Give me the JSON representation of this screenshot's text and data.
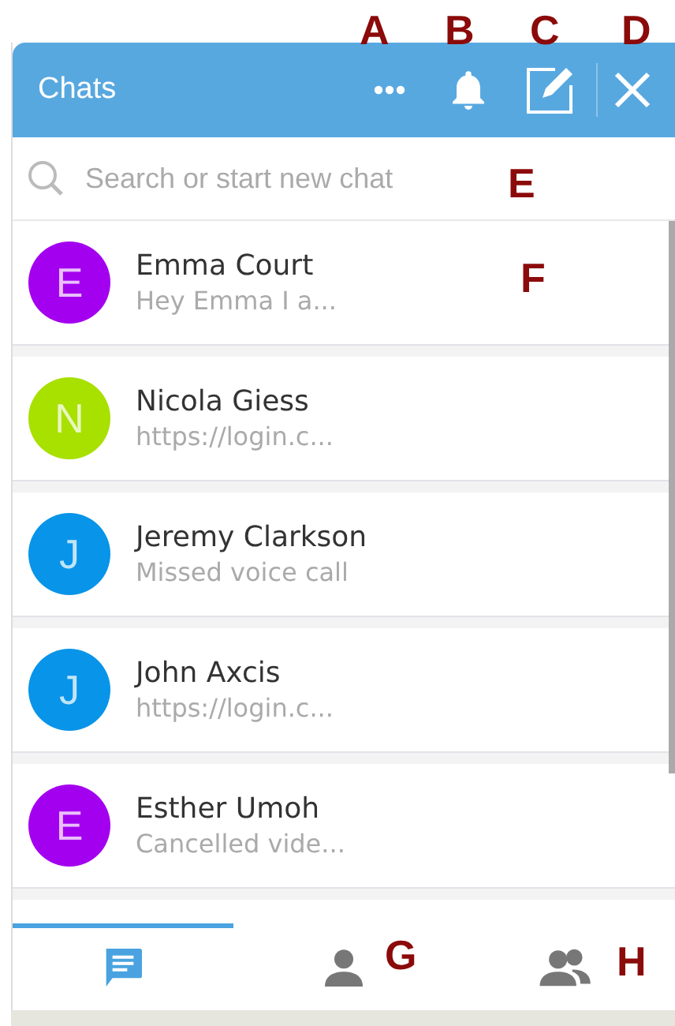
{
  "header": {
    "title": "Chats"
  },
  "search": {
    "placeholder": "Search or start new chat"
  },
  "chats": [
    {
      "initial": "E",
      "color": "#a400f0",
      "name": "Emma Court",
      "preview": "Hey Emma I a..."
    },
    {
      "initial": "N",
      "color": "#a8e000",
      "name": "Nicola Giess",
      "preview": "https://login.c..."
    },
    {
      "initial": "J",
      "color": "#0894e8",
      "name": "Jeremy Clarkson",
      "preview": "Missed voice call"
    },
    {
      "initial": "J",
      "color": "#0894e8",
      "name": "John Axcis",
      "preview": "https://login.c..."
    },
    {
      "initial": "E",
      "color": "#a400f0",
      "name": "Esther Umoh",
      "preview": "Cancelled vide..."
    }
  ],
  "tabs": [
    {
      "kind": "chats",
      "selected": true
    },
    {
      "kind": "contacts",
      "selected": false
    },
    {
      "kind": "groups",
      "selected": false
    }
  ],
  "annotations": [
    "A",
    "B",
    "C",
    "D",
    "E",
    "F",
    "G",
    "H"
  ]
}
